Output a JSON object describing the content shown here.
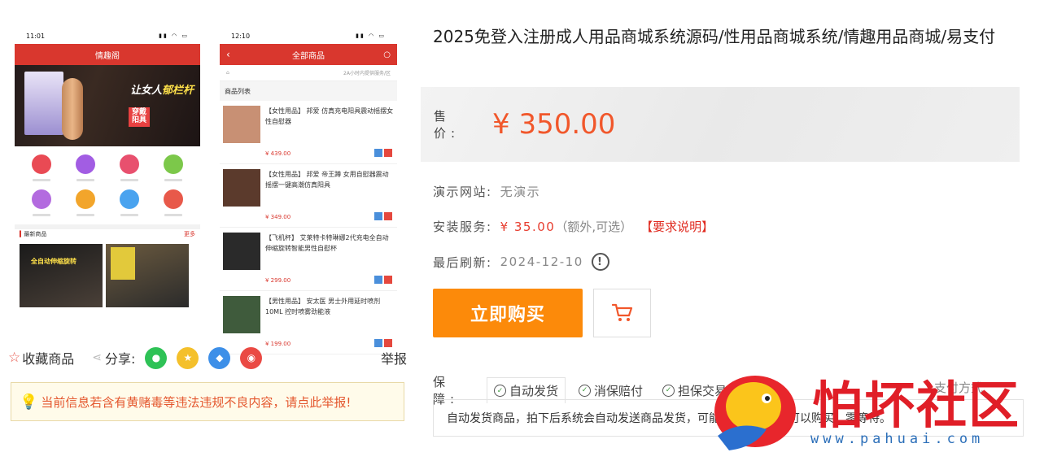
{
  "preview": {
    "phone_a": {
      "time": "11:01",
      "title": "情趣阁",
      "banner_text_1": "让女人",
      "banner_text_2": "郁栏杆",
      "banner_badge": "穿戴\n阳具",
      "section_label": "最新商品",
      "section_more": "更多",
      "icon_colors": [
        "#e94a54",
        "#a25de3",
        "#e8506e",
        "#7cc84a",
        "#b36bdf",
        "#f2a52b",
        "#4aa3ef",
        "#e8594a"
      ]
    },
    "phone_b": {
      "time": "12:10",
      "title": "全部商品",
      "topline_right": "2A小时内提供服务/区",
      "list_header": "商品列表",
      "items": [
        {
          "title": "【女性用品】 邦爱 仿真充电阳具震动摇摆女性自慰器",
          "price": "¥ 439.00",
          "img": "#c89074"
        },
        {
          "title": "【女性用品】 邦爱 帝王蹲 女用自慰器震动摇摆一键高潮仿真阳具",
          "price": "¥ 349.00",
          "img": "#5b3a2c"
        },
        {
          "title": "【飞机杯】 艾莱特卡特琳娜2代充电全自动伸缩旋转智能男性自慰杯",
          "price": "¥ 299.00",
          "img": "#2a2a2a"
        },
        {
          "title": "【男性用品】 安太医 男士外用延时喷剂10ML 控时喷雾劲能液",
          "price": "¥ 199.00",
          "img": "#3f5b3c"
        }
      ]
    }
  },
  "actions": {
    "favorite": "收藏商品",
    "share": "分享:",
    "report": "举报",
    "share_colors": [
      "#2ec256",
      "#f4c02b",
      "#3d8fe8",
      "#ea4a44"
    ]
  },
  "warning": "当前信息若含有黄赌毒等违法违规不良内容，请点此举报!",
  "product": {
    "title": "2025免登入注册成人用品商城系统源码/性用品商城系统/情趣用品商城/易支付",
    "price_label": "售　价:",
    "price": "¥ 350.00",
    "demo_label": "演示网站:",
    "demo_value": "无演示",
    "install_label": "安装服务:",
    "install_price": "¥ 35.00",
    "install_note": "（额外,可选）",
    "install_link": "【要求说明】",
    "refresh_label": "最后刷新:",
    "refresh_value": "2024-12-10",
    "buy_label": "立即购买",
    "guarantee_label": "保　障:",
    "guarantees": [
      "自动发货",
      "消保赔付",
      "担保交易"
    ],
    "pay_mode": "支付方式",
    "guarantee_desc": "自动发货商品，拍下后系统会自动发送商品发货，可能是链接，随时可以购买，零等待。"
  },
  "watermark": {
    "text": "怕坏社区",
    "url": "www.pahuai.com"
  },
  "colors": {
    "accent": "#f1572b",
    "buy": "#fc8a0a",
    "app_red": "#d9372e"
  }
}
